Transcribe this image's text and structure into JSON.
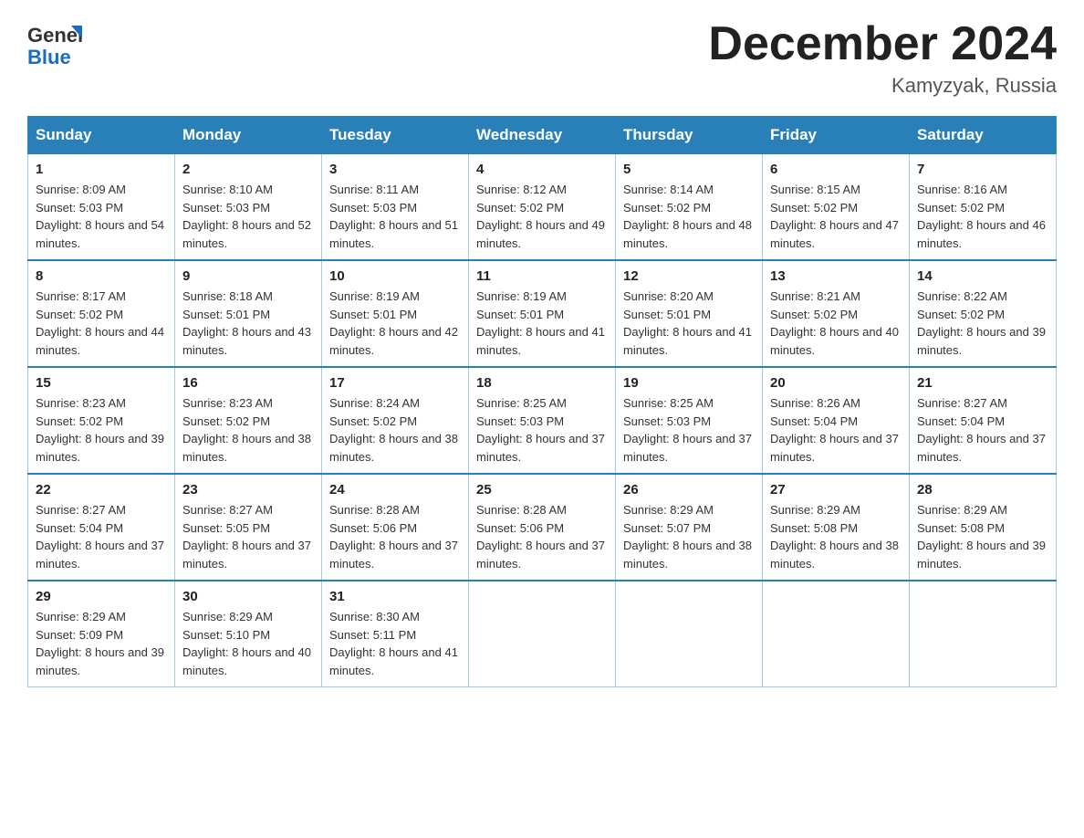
{
  "header": {
    "logo_general": "General",
    "logo_blue": "Blue",
    "title": "December 2024",
    "location": "Kamyzyak, Russia"
  },
  "days_of_week": [
    "Sunday",
    "Monday",
    "Tuesday",
    "Wednesday",
    "Thursday",
    "Friday",
    "Saturday"
  ],
  "weeks": [
    [
      {
        "day": "1",
        "sunrise": "8:09 AM",
        "sunset": "5:03 PM",
        "daylight": "8 hours and 54 minutes."
      },
      {
        "day": "2",
        "sunrise": "8:10 AM",
        "sunset": "5:03 PM",
        "daylight": "8 hours and 52 minutes."
      },
      {
        "day": "3",
        "sunrise": "8:11 AM",
        "sunset": "5:03 PM",
        "daylight": "8 hours and 51 minutes."
      },
      {
        "day": "4",
        "sunrise": "8:12 AM",
        "sunset": "5:02 PM",
        "daylight": "8 hours and 49 minutes."
      },
      {
        "day": "5",
        "sunrise": "8:14 AM",
        "sunset": "5:02 PM",
        "daylight": "8 hours and 48 minutes."
      },
      {
        "day": "6",
        "sunrise": "8:15 AM",
        "sunset": "5:02 PM",
        "daylight": "8 hours and 47 minutes."
      },
      {
        "day": "7",
        "sunrise": "8:16 AM",
        "sunset": "5:02 PM",
        "daylight": "8 hours and 46 minutes."
      }
    ],
    [
      {
        "day": "8",
        "sunrise": "8:17 AM",
        "sunset": "5:02 PM",
        "daylight": "8 hours and 44 minutes."
      },
      {
        "day": "9",
        "sunrise": "8:18 AM",
        "sunset": "5:01 PM",
        "daylight": "8 hours and 43 minutes."
      },
      {
        "day": "10",
        "sunrise": "8:19 AM",
        "sunset": "5:01 PM",
        "daylight": "8 hours and 42 minutes."
      },
      {
        "day": "11",
        "sunrise": "8:19 AM",
        "sunset": "5:01 PM",
        "daylight": "8 hours and 41 minutes."
      },
      {
        "day": "12",
        "sunrise": "8:20 AM",
        "sunset": "5:01 PM",
        "daylight": "8 hours and 41 minutes."
      },
      {
        "day": "13",
        "sunrise": "8:21 AM",
        "sunset": "5:02 PM",
        "daylight": "8 hours and 40 minutes."
      },
      {
        "day": "14",
        "sunrise": "8:22 AM",
        "sunset": "5:02 PM",
        "daylight": "8 hours and 39 minutes."
      }
    ],
    [
      {
        "day": "15",
        "sunrise": "8:23 AM",
        "sunset": "5:02 PM",
        "daylight": "8 hours and 39 minutes."
      },
      {
        "day": "16",
        "sunrise": "8:23 AM",
        "sunset": "5:02 PM",
        "daylight": "8 hours and 38 minutes."
      },
      {
        "day": "17",
        "sunrise": "8:24 AM",
        "sunset": "5:02 PM",
        "daylight": "8 hours and 38 minutes."
      },
      {
        "day": "18",
        "sunrise": "8:25 AM",
        "sunset": "5:03 PM",
        "daylight": "8 hours and 37 minutes."
      },
      {
        "day": "19",
        "sunrise": "8:25 AM",
        "sunset": "5:03 PM",
        "daylight": "8 hours and 37 minutes."
      },
      {
        "day": "20",
        "sunrise": "8:26 AM",
        "sunset": "5:04 PM",
        "daylight": "8 hours and 37 minutes."
      },
      {
        "day": "21",
        "sunrise": "8:27 AM",
        "sunset": "5:04 PM",
        "daylight": "8 hours and 37 minutes."
      }
    ],
    [
      {
        "day": "22",
        "sunrise": "8:27 AM",
        "sunset": "5:04 PM",
        "daylight": "8 hours and 37 minutes."
      },
      {
        "day": "23",
        "sunrise": "8:27 AM",
        "sunset": "5:05 PM",
        "daylight": "8 hours and 37 minutes."
      },
      {
        "day": "24",
        "sunrise": "8:28 AM",
        "sunset": "5:06 PM",
        "daylight": "8 hours and 37 minutes."
      },
      {
        "day": "25",
        "sunrise": "8:28 AM",
        "sunset": "5:06 PM",
        "daylight": "8 hours and 37 minutes."
      },
      {
        "day": "26",
        "sunrise": "8:29 AM",
        "sunset": "5:07 PM",
        "daylight": "8 hours and 38 minutes."
      },
      {
        "day": "27",
        "sunrise": "8:29 AM",
        "sunset": "5:08 PM",
        "daylight": "8 hours and 38 minutes."
      },
      {
        "day": "28",
        "sunrise": "8:29 AM",
        "sunset": "5:08 PM",
        "daylight": "8 hours and 39 minutes."
      }
    ],
    [
      {
        "day": "29",
        "sunrise": "8:29 AM",
        "sunset": "5:09 PM",
        "daylight": "8 hours and 39 minutes."
      },
      {
        "day": "30",
        "sunrise": "8:29 AM",
        "sunset": "5:10 PM",
        "daylight": "8 hours and 40 minutes."
      },
      {
        "day": "31",
        "sunrise": "8:30 AM",
        "sunset": "5:11 PM",
        "daylight": "8 hours and 41 minutes."
      },
      null,
      null,
      null,
      null
    ]
  ]
}
